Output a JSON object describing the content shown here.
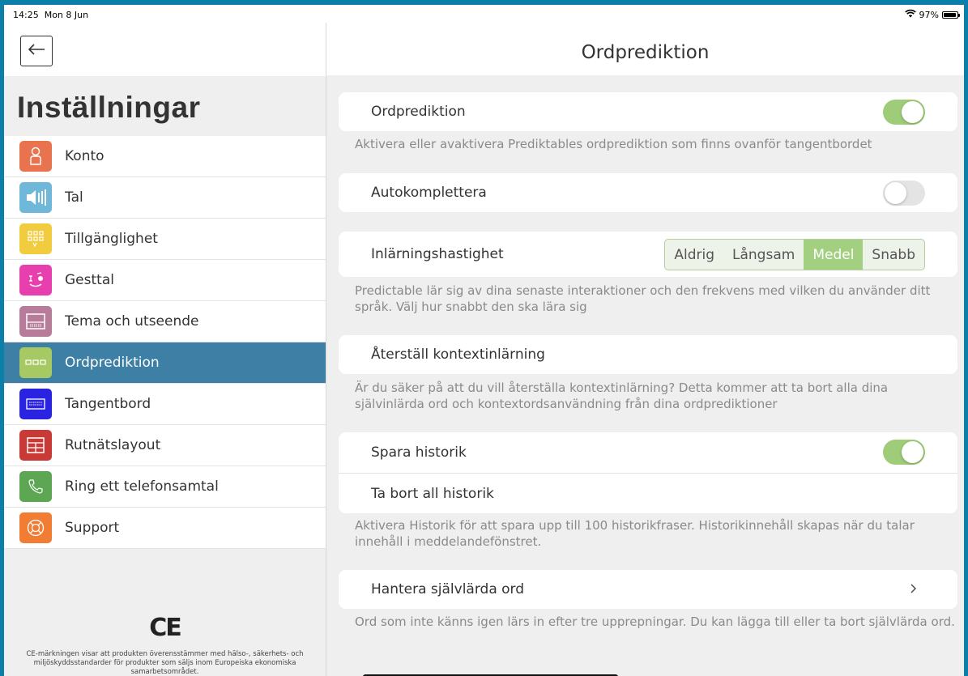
{
  "status": {
    "time": "14:25",
    "date": "Mon 8 Jun",
    "battery": "97%"
  },
  "sidebar": {
    "title": "Inställningar",
    "items": [
      {
        "label": "Konto",
        "color": "#e8734e",
        "icon": "person-icon"
      },
      {
        "label": "Tal",
        "color": "#6fb8d9",
        "icon": "speaker-icon"
      },
      {
        "label": "Tillgänglighet",
        "color": "#f2cc3f",
        "icon": "grid-icon"
      },
      {
        "label": "Gesttal",
        "color": "#e83fae",
        "icon": "gesture-face-icon"
      },
      {
        "label": "Tema och utseende",
        "color": "#b77c99",
        "icon": "theme-icon"
      },
      {
        "label": "Ordprediktion",
        "color": "#a7c964",
        "icon": "word-prediction-icon",
        "selected": true
      },
      {
        "label": "Tangentbord",
        "color": "#2a24e0",
        "icon": "keyboard-icon"
      },
      {
        "label": "Rutnätslayout",
        "color": "#c93a37",
        "icon": "grid-layout-icon"
      },
      {
        "label": "Ring ett telefonsamtal",
        "color": "#5da653",
        "icon": "phone-icon"
      },
      {
        "label": "Support",
        "color": "#f07d33",
        "icon": "lifebuoy-icon"
      }
    ],
    "ce_mark": "CE",
    "ce_text": "CE-märkningen visar att produkten överensstämmer med hälso-, säkerhets- och miljöskyddsstandarder för produkter som säljs inom Europeiska ekonomiska samarbetsområdet."
  },
  "main": {
    "title": "Ordprediktion",
    "word_prediction": {
      "label": "Ordprediktion",
      "enabled": true,
      "desc": "Aktivera eller avaktivera Prediktables ordprediktion som finns ovanför tangentbordet"
    },
    "autocomplete": {
      "label": "Autokomplettera",
      "enabled": false
    },
    "learning_speed": {
      "label": "Inlärningshastighet",
      "options": [
        "Aldrig",
        "Långsam",
        "Medel",
        "Snabb"
      ],
      "selected": "Medel",
      "desc": "Predictable lär sig av dina senaste interaktioner och den frekvens med vilken du använder ditt språk. Välj hur snabbt den ska lära sig"
    },
    "reset_context": {
      "label": "Återställ kontextinlärning",
      "desc": "Är du säker på att du vill återställa kontextinlärning? Detta kommer att ta bort alla dina självinlärda ord och kontextordsanvändning från dina ordprediktioner"
    },
    "history": {
      "save_label": "Spara historik",
      "enabled": true,
      "delete_label": "Ta bort all historik",
      "desc": "Aktivera Historik för att spara upp till 100 historikfraser. Historikinnehåll skapas när du talar innehåll i meddelandefönstret."
    },
    "learned_words": {
      "label": "Hantera självlärda ord",
      "desc": "Ord som inte känns igen lärs in efter tre upprepningar. Du kan lägga till eller ta bort självlärda ord."
    }
  }
}
